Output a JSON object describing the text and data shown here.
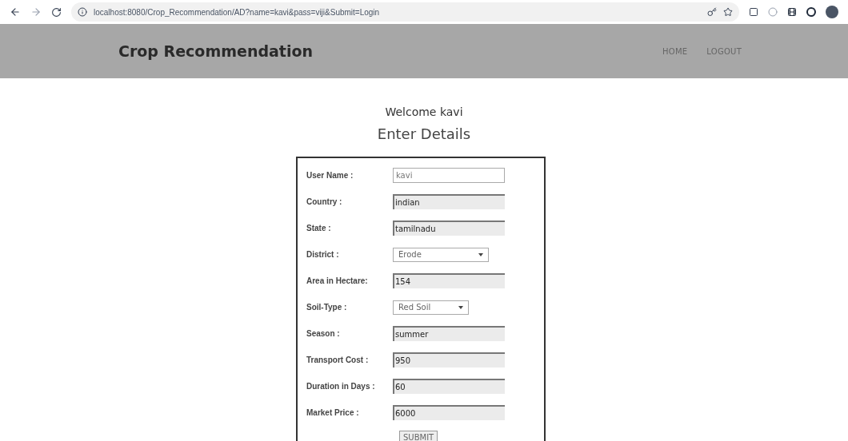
{
  "browser": {
    "url": "localhost:8080/Crop_Recommendation/AD?name=kavi&pass=viji&Submit=Login"
  },
  "header": {
    "title": "Crop Recommendation",
    "nav": [
      "HOME",
      "LOGOUT"
    ]
  },
  "welcome": "Welcome kavi",
  "heading": "Enter Details",
  "form": {
    "fields": [
      {
        "label": "User Name :",
        "kind": "input",
        "shaded": false,
        "value": "kavi"
      },
      {
        "label": "Country :",
        "kind": "input",
        "shaded": true,
        "value": "indian"
      },
      {
        "label": "State :",
        "kind": "input",
        "shaded": true,
        "value": "tamilnadu"
      },
      {
        "label": "District :",
        "kind": "select",
        "value": "Erode"
      },
      {
        "label": "Area in Hectare:",
        "kind": "input",
        "shaded": true,
        "value": "154"
      },
      {
        "label": "Soil-Type :",
        "kind": "select",
        "value": "Red Soil"
      },
      {
        "label": "Season :",
        "kind": "input",
        "shaded": true,
        "value": "summer"
      },
      {
        "label": "Transport Cost :",
        "kind": "input",
        "shaded": true,
        "value": "950"
      },
      {
        "label": "Duration in Days :",
        "kind": "input",
        "shaded": true,
        "value": "60"
      },
      {
        "label": "Market Price :",
        "kind": "input",
        "shaded": true,
        "value": "6000"
      }
    ],
    "submit": "SUBMIT"
  }
}
